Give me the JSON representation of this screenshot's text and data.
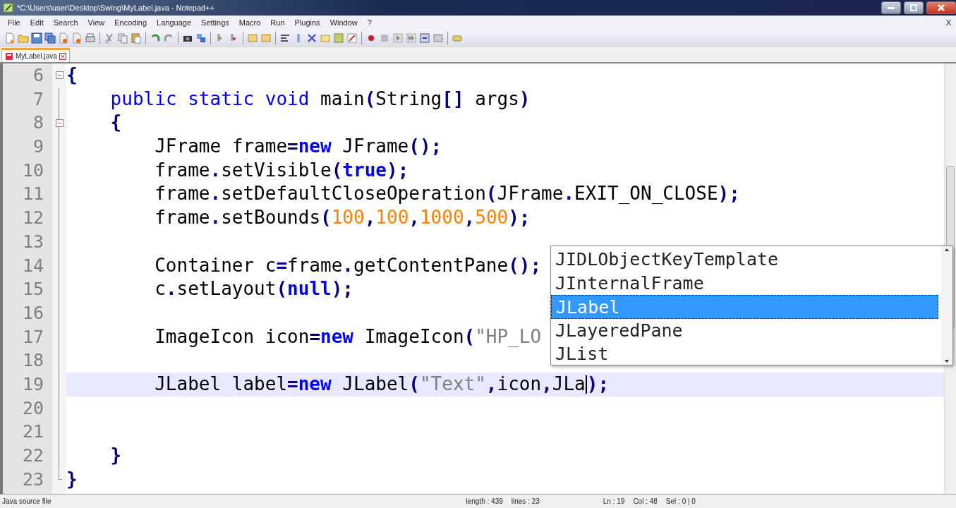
{
  "window": {
    "title": "*C:\\Users\\user\\Desktop\\Swing\\MyLabel.java - Notepad++"
  },
  "menu": [
    "File",
    "Edit",
    "Search",
    "View",
    "Encoding",
    "Language",
    "Settings",
    "Macro",
    "Run",
    "Plugins",
    "Window",
    "?"
  ],
  "menu_close": "X",
  "tabs": [
    {
      "label": "MyLabel.java",
      "selected": true,
      "modified": true
    }
  ],
  "editor": {
    "lines": [
      {
        "number": "6",
        "fold_marker": true,
        "current": false,
        "tokens": [
          {
            "text": "{",
            "kind": "operator"
          }
        ],
        "children": [
          {
            "number": "7",
            "fold_marker": false,
            "current": false,
            "tokens": [
              {
                "text": "public static void",
                "kind": "keyword"
              },
              {
                "text": " main",
                "kind": "plain"
              },
              {
                "text": "(",
                "kind": "operator"
              },
              {
                "text": "String",
                "kind": "plain"
              },
              {
                "text": "[]",
                "kind": "operator"
              },
              {
                "text": " args",
                "kind": "plain"
              },
              {
                "text": ")",
                "kind": "operator"
              }
            ]
          },
          {
            "number": "8",
            "fold_marker": true,
            "current": false,
            "tokens": [
              {
                "text": "{",
                "kind": "operator"
              }
            ],
            "children": [
              {
                "number": "9",
                "fold_marker": false,
                "current": false,
                "tokens": [
                  {
                    "text": "JFrame frame",
                    "kind": "plain"
                  },
                  {
                    "text": "=",
                    "kind": "operator"
                  },
                  {
                    "text": "new",
                    "kind": "keyword-bold"
                  },
                  {
                    "text": " JFrame",
                    "kind": "plain"
                  },
                  {
                    "text": "();",
                    "kind": "operator"
                  }
                ]
              },
              {
                "number": "10",
                "fold_marker": false,
                "current": false,
                "tokens": [
                  {
                    "text": "frame",
                    "kind": "plain"
                  },
                  {
                    "text": ".",
                    "kind": "operator"
                  },
                  {
                    "text": "setVisible",
                    "kind": "plain"
                  },
                  {
                    "text": "(",
                    "kind": "operator"
                  },
                  {
                    "text": "true",
                    "kind": "keyword-bold"
                  },
                  {
                    "text": ");",
                    "kind": "operator"
                  }
                ]
              },
              {
                "number": "11",
                "fold_marker": false,
                "current": false,
                "tokens": [
                  {
                    "text": "frame",
                    "kind": "plain"
                  },
                  {
                    "text": ".",
                    "kind": "operator"
                  },
                  {
                    "text": "setDefaultCloseOperation",
                    "kind": "plain"
                  },
                  {
                    "text": "(",
                    "kind": "operator"
                  },
                  {
                    "text": "JFrame",
                    "kind": "plain"
                  },
                  {
                    "text": ".",
                    "kind": "operator"
                  },
                  {
                    "text": "EXIT_ON_CLOSE",
                    "kind": "plain"
                  },
                  {
                    "text": ");",
                    "kind": "operator"
                  }
                ]
              },
              {
                "number": "12",
                "fold_marker": false,
                "current": false,
                "tokens": [
                  {
                    "text": "frame",
                    "kind": "plain"
                  },
                  {
                    "text": ".",
                    "kind": "operator"
                  },
                  {
                    "text": "setBounds",
                    "kind": "plain"
                  },
                  {
                    "text": "(",
                    "kind": "operator"
                  },
                  {
                    "text": "100",
                    "kind": "number"
                  },
                  {
                    "text": ",",
                    "kind": "operator"
                  },
                  {
                    "text": "100",
                    "kind": "number"
                  },
                  {
                    "text": ",",
                    "kind": "operator"
                  },
                  {
                    "text": "1000",
                    "kind": "number"
                  },
                  {
                    "text": ",",
                    "kind": "operator"
                  },
                  {
                    "text": "500",
                    "kind": "number"
                  },
                  {
                    "text": ");",
                    "kind": "operator"
                  }
                ]
              },
              {
                "number": "13",
                "fold_marker": false,
                "current": false
              },
              {
                "number": "14",
                "fold_marker": false,
                "current": false,
                "tokens": [
                  {
                    "text": "Container c",
                    "kind": "plain"
                  },
                  {
                    "text": "=",
                    "kind": "operator"
                  },
                  {
                    "text": "frame",
                    "kind": "plain"
                  },
                  {
                    "text": ".",
                    "kind": "operator"
                  },
                  {
                    "text": "getContentPane",
                    "kind": "plain"
                  },
                  {
                    "text": "();",
                    "kind": "operator"
                  }
                ]
              },
              {
                "number": "15",
                "fold_marker": false,
                "current": false,
                "tokens": [
                  {
                    "text": "c",
                    "kind": "plain"
                  },
                  {
                    "text": ".",
                    "kind": "operator"
                  },
                  {
                    "text": "setLayout",
                    "kind": "plain"
                  },
                  {
                    "text": "(",
                    "kind": "operator"
                  },
                  {
                    "text": "null",
                    "kind": "keyword-bold"
                  },
                  {
                    "text": ");",
                    "kind": "operator"
                  }
                ]
              },
              {
                "number": "16",
                "fold_marker": false,
                "current": false
              },
              {
                "number": "17",
                "fold_marker": false,
                "current": false,
                "tokens": [
                  {
                    "text": "ImageIcon icon",
                    "kind": "plain"
                  },
                  {
                    "text": "=",
                    "kind": "operator"
                  },
                  {
                    "text": "new",
                    "kind": "keyword-bold"
                  },
                  {
                    "text": " ImageIcon",
                    "kind": "plain"
                  },
                  {
                    "text": "(",
                    "kind": "operator"
                  },
                  {
                    "text": "\"HP_LO",
                    "kind": "string"
                  }
                ]
              },
              {
                "number": "18",
                "fold_marker": false,
                "current": false
              },
              {
                "number": "19",
                "fold_marker": false,
                "current": true,
                "tokens": [
                  {
                    "text": "JLabel label",
                    "kind": "plain"
                  },
                  {
                    "text": "=",
                    "kind": "operator"
                  },
                  {
                    "text": "new",
                    "kind": "keyword-bold"
                  },
                  {
                    "text": " JLabel",
                    "kind": "plain"
                  },
                  {
                    "text": "(",
                    "kind": "operator"
                  },
                  {
                    "text": "\"Text\"",
                    "kind": "string"
                  },
                  {
                    "text": ",",
                    "kind": "operator"
                  },
                  {
                    "text": "icon",
                    "kind": "plain"
                  },
                  {
                    "text": ",",
                    "kind": "operator"
                  },
                  {
                    "text": "JLa",
                    "kind": "plain",
                    "caret": true
                  },
                  {
                    "text": ");",
                    "kind": "operator"
                  }
                ]
              },
              {
                "number": "20",
                "fold_marker": false,
                "current": false
              },
              {
                "number": "21",
                "fold_marker": false,
                "current": false
              }
            ]
          },
          {
            "number": "22",
            "fold_marker": false,
            "current": false,
            "tokens": [
              {
                "text": "}",
                "kind": "operator"
              }
            ]
          }
        ]
      },
      {
        "number": "23",
        "fold_marker": false,
        "current": false,
        "tokens": [
          {
            "text": "}",
            "kind": "operator"
          }
        ]
      }
    ]
  },
  "autocomplete": [
    {
      "label": "JIDLObjectKeyTemplate",
      "selected": false
    },
    {
      "label": "JInternalFrame",
      "selected": false
    },
    {
      "label": "JLabel",
      "selected": true
    },
    {
      "label": "JLayeredPane",
      "selected": false
    },
    {
      "label": "JList",
      "selected": false
    }
  ],
  "status_bar": {
    "file_type": "Java source file",
    "length": "length : 439",
    "lines": "lines : 23",
    "ln": "Ln : 19",
    "col": "Col : 48",
    "sel": "Sel : 0 | 0"
  }
}
